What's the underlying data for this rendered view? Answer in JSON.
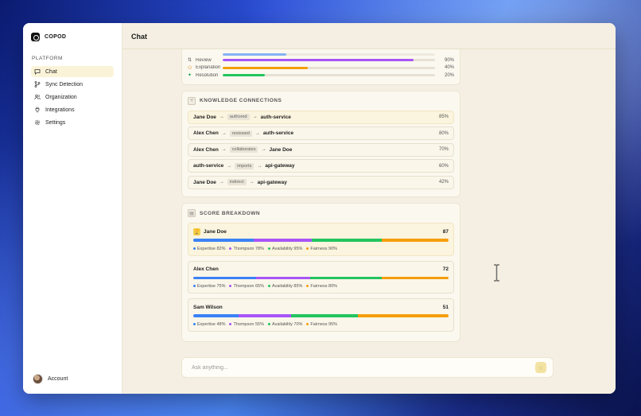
{
  "app": {
    "brand": "COPOD"
  },
  "sidebar": {
    "section": "PLATFORM",
    "items": [
      {
        "label": "Chat",
        "icon": "chat-icon",
        "active": true
      },
      {
        "label": "Sync Detection",
        "icon": "branch-icon"
      },
      {
        "label": "Organization",
        "icon": "users-icon"
      },
      {
        "label": "Integrations",
        "icon": "plug-icon"
      },
      {
        "label": "Settings",
        "icon": "gear-icon"
      }
    ],
    "account": "Account"
  },
  "header": {
    "title": "Chat"
  },
  "metrics": [
    {
      "label": "Review",
      "value": "90%",
      "fraction": 0.9,
      "color": "#a855f7"
    },
    {
      "label": "Explanation",
      "value": "40%",
      "fraction": 0.4,
      "color": "#f59e0b"
    },
    {
      "label": "Resolution",
      "value": "20%",
      "fraction": 0.2,
      "color": "#22c55e"
    }
  ],
  "knowledge": {
    "title": "KNOWLEDGE CONNECTIONS",
    "rows": [
      {
        "from": "Jane Doe",
        "relation": "authored",
        "to": "auth-service",
        "pct": "85%"
      },
      {
        "from": "Alex Chen",
        "relation": "reviewed",
        "to": "auth-service",
        "pct": "80%"
      },
      {
        "from": "Alex Chen",
        "relation": "collaborates",
        "to": "Jane Doe",
        "pct": "70%"
      },
      {
        "from": "auth-service",
        "relation": "imports",
        "to": "api-gateway",
        "pct": "60%"
      },
      {
        "from": "Jane Doe",
        "relation": "indirect",
        "to": "api-gateway",
        "pct": "42%"
      }
    ]
  },
  "scores": {
    "title": "SCORE BREAKDOWN",
    "colors": {
      "expertise": "#3b82f6",
      "thompson": "#a855f7",
      "availability": "#22c55e",
      "fairness": "#f59e0b"
    },
    "people": [
      {
        "name": "Jane Doe",
        "total": "87",
        "expertise": 82,
        "thompson": 78,
        "availability": 95,
        "fairness": 90,
        "legend": [
          "Expertise 82%",
          "Thompson 78%",
          "Availability 95%",
          "Fairness 90%"
        ]
      },
      {
        "name": "Alex Chen",
        "total": "72",
        "expertise": 75,
        "thompson": 65,
        "availability": 85,
        "fairness": 80,
        "legend": [
          "Expertise 75%",
          "Thompson 65%",
          "Availability 85%",
          "Fairness 80%"
        ]
      },
      {
        "name": "Sam Wilson",
        "total": "51",
        "expertise": 48,
        "thompson": 55,
        "availability": 70,
        "fairness": 95,
        "legend": [
          "Expertise 48%",
          "Thompson 55%",
          "Availability 70%",
          "Fairness 95%"
        ]
      }
    ]
  },
  "chat_input": {
    "placeholder": "Ask anything..."
  }
}
